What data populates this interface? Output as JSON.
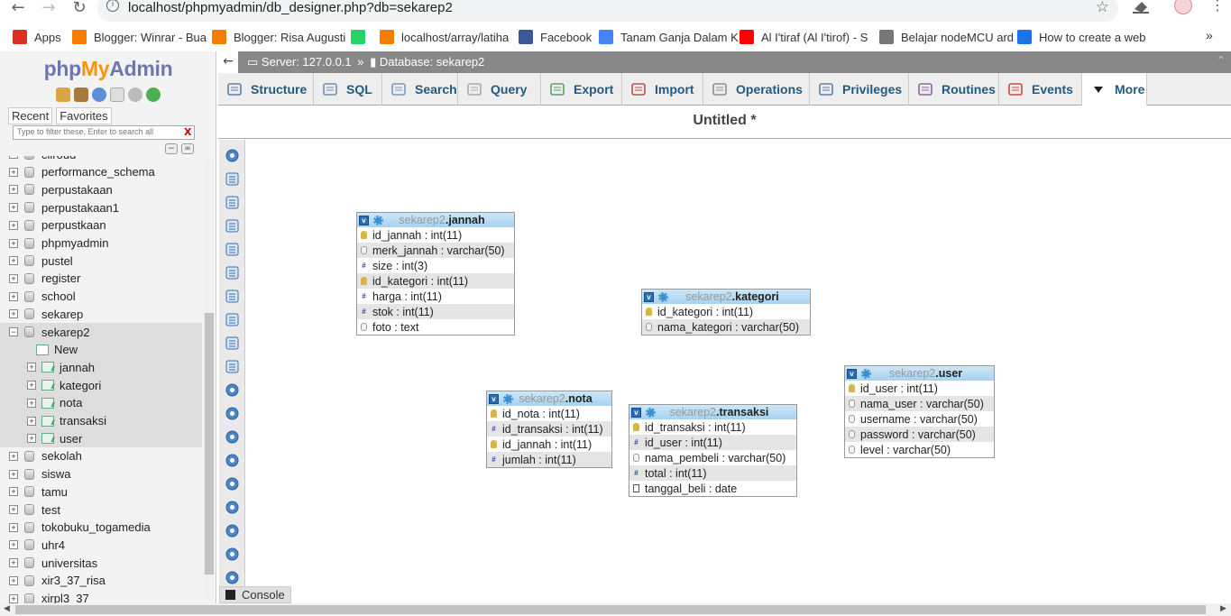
{
  "browser": {
    "url": "localhost/phpmyadmin/db_designer.php?db=sekarep2",
    "bookmarks": [
      {
        "label": "Apps",
        "icon": "apps-grid-icon",
        "color": "#d93025"
      },
      {
        "label": "Blogger: Winrar - Bua",
        "icon": "blogger-icon",
        "color": "#f57d00"
      },
      {
        "label": "Blogger: Risa Augusti",
        "icon": "blogger-icon",
        "color": "#f57d00"
      },
      {
        "label": "",
        "icon": "whatsapp-icon",
        "color": "#25d366"
      },
      {
        "label": "localhost/array/latiha",
        "icon": "localhost-icon",
        "color": "#f57d00"
      },
      {
        "label": "Facebook",
        "icon": "facebook-icon",
        "color": "#3b5998"
      },
      {
        "label": "Tanam Ganja Dalam K",
        "icon": "google-g-icon",
        "color": "#4285f4"
      },
      {
        "label": "Al I'tiraf (Al I'tirof) - S",
        "icon": "youtube-icon",
        "color": "#ff0000"
      },
      {
        "label": "Belajar nodeMCU ard",
        "icon": "page-icon",
        "color": "#777777"
      },
      {
        "label": "How to create a web",
        "icon": "hatena-icon",
        "color": "#1a73e8"
      }
    ]
  },
  "sidebar": {
    "logo": {
      "php": "php",
      "my": "My",
      "admin": "Admin"
    },
    "recent_label": "Recent",
    "favorites_label": "Favorites",
    "filter_placeholder": "Type to filter these, Enter to search all",
    "filter_clear": "X",
    "databases": [
      {
        "name": "ciiroud",
        "state": "collapsed"
      },
      {
        "name": "performance_schema",
        "state": "collapsed"
      },
      {
        "name": "perpustakaan",
        "state": "collapsed"
      },
      {
        "name": "perpustakaan1",
        "state": "collapsed"
      },
      {
        "name": "perpustkaan",
        "state": "collapsed"
      },
      {
        "name": "phpmyadmin",
        "state": "collapsed"
      },
      {
        "name": "pustel",
        "state": "collapsed"
      },
      {
        "name": "register",
        "state": "collapsed"
      },
      {
        "name": "school",
        "state": "collapsed"
      },
      {
        "name": "sekarep",
        "state": "collapsed"
      },
      {
        "name": "sekarep2",
        "state": "expanded"
      },
      {
        "name": "sekolah",
        "state": "collapsed"
      },
      {
        "name": "siswa",
        "state": "collapsed"
      },
      {
        "name": "tamu",
        "state": "collapsed"
      },
      {
        "name": "test",
        "state": "collapsed"
      },
      {
        "name": "tokobuku_togamedia",
        "state": "collapsed"
      },
      {
        "name": "uhr4",
        "state": "collapsed"
      },
      {
        "name": "universitas",
        "state": "collapsed"
      },
      {
        "name": "xir3_37_risa",
        "state": "collapsed"
      },
      {
        "name": "xirpl3_37",
        "state": "collapsed"
      }
    ],
    "sekarep2_children": [
      "New",
      "jannah",
      "kategori",
      "nota",
      "transaksi",
      "user"
    ]
  },
  "topbar": {
    "server": "Server: 127.0.0.1",
    "database": "Database: sekarep2"
  },
  "tabs": [
    "Structure",
    "SQL",
    "Search",
    "Query",
    "Export",
    "Import",
    "Operations",
    "Privileges",
    "Routines",
    "Events",
    "More"
  ],
  "designer": {
    "title": "Untitled *",
    "tables": [
      {
        "db": "sekarep2",
        "name": "jannah",
        "columns": [
          {
            "text": "id_jannah : int(11)",
            "type": "key"
          },
          {
            "text": "merk_jannah : varchar(50)",
            "type": "str"
          },
          {
            "text": "size : int(3)",
            "type": "num"
          },
          {
            "text": "id_kategori : int(11)",
            "type": "key"
          },
          {
            "text": "harga : int(11)",
            "type": "num"
          },
          {
            "text": "stok : int(11)",
            "type": "num"
          },
          {
            "text": "foto : text",
            "type": "str"
          }
        ]
      },
      {
        "db": "sekarep2",
        "name": "kategori",
        "columns": [
          {
            "text": "id_kategori : int(11)",
            "type": "key"
          },
          {
            "text": "nama_kategori : varchar(50)",
            "type": "str"
          }
        ]
      },
      {
        "db": "sekarep2",
        "name": "nota",
        "columns": [
          {
            "text": "id_nota : int(11)",
            "type": "key"
          },
          {
            "text": "id_transaksi : int(11)",
            "type": "num"
          },
          {
            "text": "id_jannah : int(11)",
            "type": "key"
          },
          {
            "text": "jumlah : int(11)",
            "type": "num"
          }
        ]
      },
      {
        "db": "sekarep2",
        "name": "transaksi",
        "columns": [
          {
            "text": "id_transaksi : int(11)",
            "type": "key"
          },
          {
            "text": "id_user : int(11)",
            "type": "num"
          },
          {
            "text": "nama_pembeli : varchar(50)",
            "type": "str"
          },
          {
            "text": "total : int(11)",
            "type": "num"
          },
          {
            "text": "tanggal_beli : date",
            "type": "date"
          }
        ]
      },
      {
        "db": "sekarep2",
        "name": "user",
        "columns": [
          {
            "text": "id_user : int(11)",
            "type": "key"
          },
          {
            "text": "nama_user : varchar(50)",
            "type": "str"
          },
          {
            "text": "username : varchar(50)",
            "type": "str"
          },
          {
            "text": "password : varchar(50)",
            "type": "str"
          },
          {
            "text": "level : varchar(50)",
            "type": "str"
          }
        ]
      }
    ]
  },
  "console_label": "Console"
}
